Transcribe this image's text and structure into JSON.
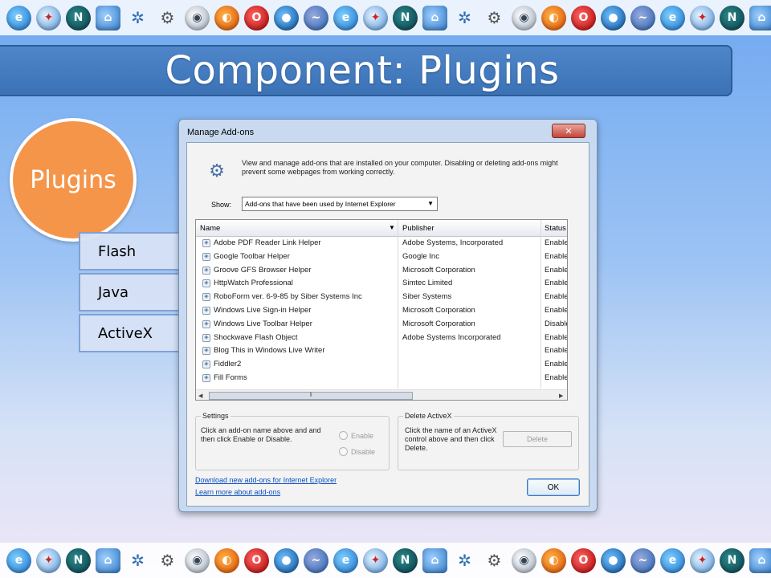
{
  "slide": {
    "title": "Component: Plugins",
    "circle_label": "Plugins",
    "side_items": [
      "Flash",
      "Java",
      "ActiveX"
    ]
  },
  "icons": {
    "strip": [
      "ie-icon",
      "safari-icon",
      "netscape-icon",
      "konqueror-icon",
      "star-icon",
      "gears-icon",
      "camino-icon",
      "firefox-icon",
      "opera-icon",
      "flock-icon",
      "seamonkey-icon",
      "ie-icon",
      "safari-icon",
      "netscape-icon",
      "konqueror-icon",
      "star-icon",
      "gears-icon",
      "camino-icon",
      "firefox-icon",
      "opera-icon",
      "flock-icon",
      "seamonkey-icon",
      "ie-icon",
      "safari-icon",
      "netscape-icon",
      "konqueror-icon",
      "star-icon"
    ]
  },
  "dialog": {
    "title": "Manage Add-ons",
    "close_glyph": "✕",
    "description": "View and manage add-ons that are installed on your computer. Disabling or deleting add-ons might prevent some webpages from working correctly.",
    "show_label": "Show:",
    "show_value": "Add-ons that have been used by Internet Explorer",
    "columns": {
      "name": "Name",
      "publisher": "Publisher",
      "status": "Status"
    },
    "rows": [
      {
        "name": "Adobe PDF Reader Link Helper",
        "publisher": "Adobe Systems, Incorporated",
        "status": "Enabled"
      },
      {
        "name": "Google Toolbar Helper",
        "publisher": "Google Inc",
        "status": "Enabled"
      },
      {
        "name": "Groove GFS Browser Helper",
        "publisher": "Microsoft Corporation",
        "status": "Enabled"
      },
      {
        "name": "HttpWatch Professional",
        "publisher": "Simtec Limited",
        "status": "Enabled"
      },
      {
        "name": "RoboForm ver. 6-9-85 by Siber Systems Inc",
        "publisher": "Siber Systems",
        "status": "Enabled"
      },
      {
        "name": "Windows Live Sign-in Helper",
        "publisher": "Microsoft Corporation",
        "status": "Enabled"
      },
      {
        "name": "Windows Live Toolbar Helper",
        "publisher": "Microsoft Corporation",
        "status": "Disabled"
      },
      {
        "name": "Shockwave Flash Object",
        "publisher": "Adobe Systems Incorporated",
        "status": "Enabled"
      },
      {
        "name": "Blog This in Windows Live Writer",
        "publisher": "",
        "status": "Enabled"
      },
      {
        "name": "Fiddler2",
        "publisher": "",
        "status": "Enabled"
      },
      {
        "name": "Fill Forms",
        "publisher": "",
        "status": "Enabled"
      }
    ],
    "settings": {
      "label": "Settings",
      "text": "Click an add-on name above and and then click Enable or Disable.",
      "enable_label": "Enable",
      "disable_label": "Disable"
    },
    "delete_activex": {
      "label": "Delete ActiveX",
      "text": "Click the name of an ActiveX control above and then click Delete.",
      "button_label": "Delete"
    },
    "links": {
      "download": "Download new add-ons for Internet Explorer",
      "learn": "Learn more about add-ons"
    },
    "ok_label": "OK"
  }
}
